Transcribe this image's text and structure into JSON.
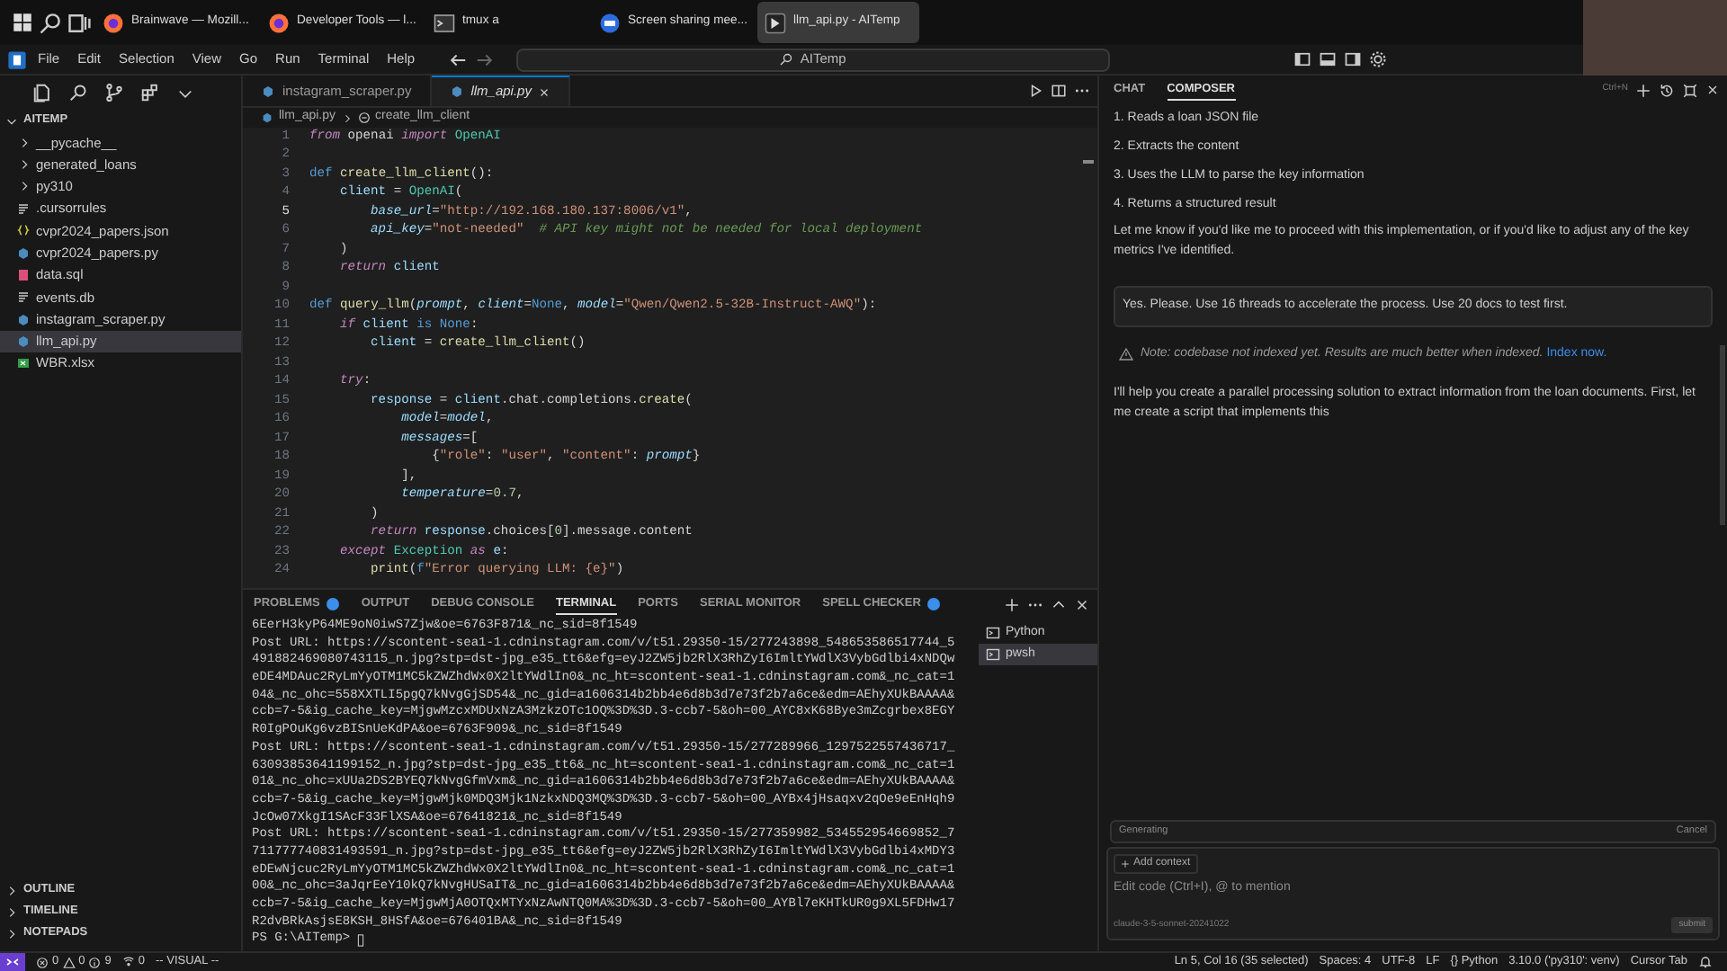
{
  "taskbar": {
    "apps": [
      {
        "label": "Brainwave — Mozill...",
        "kind": "browser",
        "selected": false
      },
      {
        "label": "Developer Tools — l...",
        "kind": "browser",
        "selected": false
      },
      {
        "label": "tmux a",
        "kind": "terminal",
        "selected": false
      },
      {
        "label": "Screen sharing mee...",
        "kind": "meeting",
        "selected": false
      },
      {
        "label": "llm_api.py - AITemp",
        "kind": "editor",
        "selected": true
      }
    ]
  },
  "menu_bar": {
    "items": [
      "File",
      "Edit",
      "Selection",
      "View",
      "Go",
      "Run",
      "Terminal",
      "Help"
    ],
    "command_center": "AITemp"
  },
  "sidebar": {
    "root": {
      "label": "AITEMP",
      "expanded": true
    },
    "items": [
      {
        "label": "__pycache__",
        "kind": "folder",
        "expanded": false,
        "selected": false
      },
      {
        "label": "generated_loans",
        "kind": "folder",
        "expanded": false,
        "selected": false
      },
      {
        "label": "py310",
        "kind": "folder",
        "expanded": false,
        "selected": false
      },
      {
        "label": ".cursorrules",
        "kind": "text",
        "selected": false
      },
      {
        "label": "cvpr2024_papers.json",
        "kind": "json",
        "selected": false
      },
      {
        "label": "cvpr2024_papers.py",
        "kind": "python",
        "selected": false
      },
      {
        "label": "data.sql",
        "kind": "sql",
        "selected": false
      },
      {
        "label": "events.db",
        "kind": "text",
        "selected": false
      },
      {
        "label": "instagram_scraper.py",
        "kind": "python",
        "selected": false
      },
      {
        "label": "llm_api.py",
        "kind": "python",
        "selected": true
      },
      {
        "label": "WBR.xlsx",
        "kind": "excel",
        "selected": false
      }
    ],
    "sections": [
      {
        "label": "OUTLINE",
        "expanded": false
      },
      {
        "label": "TIMELINE",
        "expanded": false
      },
      {
        "label": "NOTEPADS",
        "expanded": false
      }
    ]
  },
  "editor": {
    "tabs": [
      {
        "label": "instagram_scraper.py",
        "selected": false
      },
      {
        "label": "llm_api.py",
        "selected": true
      }
    ],
    "breadcrumb": [
      "llm_api.py",
      "create_llm_client"
    ],
    "lines": [
      {
        "number": "1",
        "current": false,
        "tokens": [
          {
            "kind": "kw",
            "text": "from"
          },
          {
            "kind": "plain",
            "text": " openai "
          },
          {
            "kind": "kw",
            "text": "import"
          },
          {
            "kind": "cls",
            "text": " OpenAI"
          }
        ]
      },
      {
        "number": "2",
        "current": false
      },
      {
        "number": "3",
        "current": false,
        "tokens": [
          {
            "kind": "def",
            "text": "def"
          },
          {
            "kind": "fn",
            "text": " create_llm_client"
          },
          {
            "kind": "plain",
            "text": "():"
          }
        ]
      },
      {
        "number": "4",
        "current": false,
        "tokens": [
          {
            "kind": "var",
            "text": "    client"
          },
          {
            "kind": "plain",
            "text": " = "
          },
          {
            "kind": "cls",
            "text": "OpenAI"
          },
          {
            "kind": "plain",
            "text": "("
          }
        ]
      },
      {
        "number": "5",
        "current": true,
        "tokens": [
          {
            "kind": "param",
            "text": "        base_url"
          },
          {
            "kind": "plain",
            "text": "="
          },
          {
            "kind": "str",
            "text": "\"http://192.168.180.137:8006/v1\""
          },
          {
            "kind": "plain",
            "text": ","
          }
        ]
      },
      {
        "number": "6",
        "current": false,
        "tokens": [
          {
            "kind": "param",
            "text": "        api_key"
          },
          {
            "kind": "plain",
            "text": "="
          },
          {
            "kind": "str",
            "text": "\"not-needed\""
          },
          {
            "kind": "comment",
            "text": "  # API key might not be needed for local deployment"
          }
        ]
      },
      {
        "number": "7",
        "current": false,
        "tokens": [
          {
            "kind": "plain",
            "text": "    )"
          }
        ]
      },
      {
        "number": "8",
        "current": false,
        "tokens": [
          {
            "kind": "kw",
            "text": "    return"
          },
          {
            "kind": "var",
            "text": " client"
          }
        ]
      },
      {
        "number": "9",
        "current": false
      },
      {
        "number": "10",
        "current": false,
        "tokens": [
          {
            "kind": "def",
            "text": "def"
          },
          {
            "kind": "fn",
            "text": " query_llm"
          },
          {
            "kind": "plain",
            "text": "("
          },
          {
            "kind": "param",
            "text": "prompt"
          },
          {
            "kind": "plain",
            "text": ", "
          },
          {
            "kind": "param",
            "text": "client"
          },
          {
            "kind": "plain",
            "text": "="
          },
          {
            "kind": "def",
            "text": "None"
          },
          {
            "kind": "plain",
            "text": ", "
          },
          {
            "kind": "param",
            "text": "model"
          },
          {
            "kind": "plain",
            "text": "="
          },
          {
            "kind": "str",
            "text": "\"Qwen/Qwen2.5-32B-Instruct-AWQ\""
          },
          {
            "kind": "plain",
            "text": "):"
          }
        ]
      },
      {
        "number": "11",
        "current": false,
        "tokens": [
          {
            "kind": "kw",
            "text": "    if"
          },
          {
            "kind": "var",
            "text": " client"
          },
          {
            "kind": "def",
            "text": " is"
          },
          {
            "kind": "def",
            "text": " None"
          },
          {
            "kind": "plain",
            "text": ":"
          }
        ]
      },
      {
        "number": "12",
        "current": false,
        "tokens": [
          {
            "kind": "var",
            "text": "        client"
          },
          {
            "kind": "plain",
            "text": " = "
          },
          {
            "kind": "fn",
            "text": "create_llm_client"
          },
          {
            "kind": "plain",
            "text": "()"
          }
        ]
      },
      {
        "number": "13",
        "current": false
      },
      {
        "number": "14",
        "current": false,
        "tokens": [
          {
            "kind": "kw",
            "text": "    try"
          },
          {
            "kind": "plain",
            "text": ":"
          }
        ]
      },
      {
        "number": "15",
        "current": false,
        "tokens": [
          {
            "kind": "var",
            "text": "        response"
          },
          {
            "kind": "plain",
            "text": " = "
          },
          {
            "kind": "var",
            "text": "client"
          },
          {
            "kind": "plain",
            "text": ".chat.completions."
          },
          {
            "kind": "fn",
            "text": "create"
          },
          {
            "kind": "plain",
            "text": "("
          }
        ]
      },
      {
        "number": "16",
        "current": false,
        "tokens": [
          {
            "kind": "param",
            "text": "            model"
          },
          {
            "kind": "plain",
            "text": "="
          },
          {
            "kind": "param",
            "text": "model"
          },
          {
            "kind": "plain",
            "text": ","
          }
        ]
      },
      {
        "number": "17",
        "current": false,
        "tokens": [
          {
            "kind": "param",
            "text": "            messages"
          },
          {
            "kind": "plain",
            "text": "=["
          }
        ]
      },
      {
        "number": "18",
        "current": false,
        "tokens": [
          {
            "kind": "plain",
            "text": "                {"
          },
          {
            "kind": "str",
            "text": "\"role\""
          },
          {
            "kind": "plain",
            "text": ": "
          },
          {
            "kind": "str",
            "text": "\"user\""
          },
          {
            "kind": "plain",
            "text": ", "
          },
          {
            "kind": "str",
            "text": "\"content\""
          },
          {
            "kind": "plain",
            "text": ": "
          },
          {
            "kind": "param",
            "text": "prompt"
          },
          {
            "kind": "plain",
            "text": "}"
          }
        ]
      },
      {
        "number": "19",
        "current": false,
        "tokens": [
          {
            "kind": "plain",
            "text": "            ],"
          }
        ]
      },
      {
        "number": "20",
        "current": false,
        "tokens": [
          {
            "kind": "param",
            "text": "            temperature"
          },
          {
            "kind": "plain",
            "text": "="
          },
          {
            "kind": "num",
            "text": "0.7"
          },
          {
            "kind": "plain",
            "text": ","
          }
        ]
      },
      {
        "number": "21",
        "current": false,
        "tokens": [
          {
            "kind": "plain",
            "text": "        )"
          }
        ]
      },
      {
        "number": "22",
        "current": false,
        "tokens": [
          {
            "kind": "kw",
            "text": "        return"
          },
          {
            "kind": "var",
            "text": " response"
          },
          {
            "kind": "plain",
            "text": ".choices["
          },
          {
            "kind": "num",
            "text": "0"
          },
          {
            "kind": "plain",
            "text": "].message.content"
          }
        ]
      },
      {
        "number": "23",
        "current": false,
        "tokens": [
          {
            "kind": "kw",
            "text": "    except"
          },
          {
            "kind": "cls",
            "text": " Exception"
          },
          {
            "kind": "kw",
            "text": " as"
          },
          {
            "kind": "var",
            "text": " e"
          },
          {
            "kind": "plain",
            "text": ":"
          }
        ]
      },
      {
        "number": "24",
        "current": false,
        "tokens": [
          {
            "kind": "fn",
            "text": "        print"
          },
          {
            "kind": "plain",
            "text": "("
          },
          {
            "kind": "def",
            "text": "f"
          },
          {
            "kind": "str",
            "text": "\"Error querying LLM: {e}\""
          },
          {
            "kind": "plain",
            "text": ")"
          }
        ]
      }
    ]
  },
  "panel": {
    "tabs": [
      {
        "label": "PROBLEMS",
        "badge": true,
        "selected": false
      },
      {
        "label": "OUTPUT",
        "badge": false,
        "selected": false
      },
      {
        "label": "DEBUG CONSOLE",
        "badge": false,
        "selected": false
      },
      {
        "label": "TERMINAL",
        "badge": false,
        "selected": true
      },
      {
        "label": "PORTS",
        "badge": false,
        "selected": false
      },
      {
        "label": "SERIAL MONITOR",
        "badge": false,
        "selected": false
      },
      {
        "label": "SPELL CHECKER",
        "badge": true,
        "selected": false
      }
    ],
    "terminal_lines": [
      "6EerH3kyP64ME9oN0iwS7Zjw&oe=6763F871&_nc_sid=8f1549",
      "Post URL: https://scontent-sea1-1.cdninstagram.com/v/t51.29350-15/277243898_548653586517744_5",
      "491882469080743115_n.jpg?stp=dst-jpg_e35_tt6&efg=eyJ2ZW5jb2RlX3RhZyI6ImltYWdlX3VybGdlbi4xNDQw",
      "eDE4MDAuc2RyLmYyOTM1MC5kZWZhdWx0X2ltYWdlIn0&_nc_ht=scontent-sea1-1.cdninstagram.com&_nc_cat=1",
      "04&_nc_ohc=558XXTLI5pgQ7kNvgGjSD54&_nc_gid=a1606314b2bb4e6d8b3d7e73f2b7a6ce&edm=AEhyXUkBAAAA&",
      "ccb=7-5&ig_cache_key=MjgwMzcxMDUxNzA3MzkzOTc1OQ%3D%3D.3-ccb7-5&oh=00_AYC8xK68Bye3mZcgrbex8EGY",
      "R0IgPOuKg6vzBISnUeKdPA&oe=6763F909&_nc_sid=8f1549",
      "Post URL: https://scontent-sea1-1.cdninstagram.com/v/t51.29350-15/277289966_1297522557436717_",
      "63093853641199152_n.jpg?stp=dst-jpg_e35_tt6&_nc_ht=scontent-sea1-1.cdninstagram.com&_nc_cat=1",
      "01&_nc_ohc=xUUa2DS2BYEQ7kNvgGfmVxm&_nc_gid=a1606314b2bb4e6d8b3d7e73f2b7a6ce&edm=AEhyXUkBAAAA&",
      "ccb=7-5&ig_cache_key=MjgwMjk0MDQ3Mjk1NzkxNDQ3MQ%3D%3D.3-ccb7-5&oh=00_AYBx4jHsaqxv2qOe9eEnHqh9",
      "JcOw07XkgI1SAcF33FlXSA&oe=67641821&_nc_sid=8f1549",
      "Post URL: https://scontent-sea1-1.cdninstagram.com/v/t51.29350-15/277359982_534552954669852_7",
      "711777740831493591_n.jpg?stp=dst-jpg_e35_tt6&efg=eyJ2ZW5jb2RlX3RhZyI6ImltYWdlX3VybGdlbi4xMDY3",
      "eDEwNjcuc2RyLmYyOTM1MC5kZWZhdWx0X2ltYWdlIn0&_nc_ht=scontent-sea1-1.cdninstagram.com&_nc_cat=1",
      "00&_nc_ohc=3aJqrEeY10kQ7kNvgHUSaIT&_nc_gid=a1606314b2bb4e6d8b3d7e73f2b7a6ce&edm=AEhyXUkBAAAA&",
      "ccb=7-5&ig_cache_key=MjgwMjA0OTQxMTYxNzAwNTQ0MA%3D%3D.3-ccb7-5&oh=00_AYBl7eKHTkUR0g9XL5FDHw17",
      "R2dvBRkAsjsE8KSH_8HSfA&oe=676401BA&_nc_sid=8f1549"
    ],
    "prompt": "PS G:\\AITemp>",
    "terminals": [
      {
        "label": "Python",
        "selected": false
      },
      {
        "label": "pwsh",
        "selected": true
      }
    ]
  },
  "composer": {
    "tabs": [
      {
        "label": "CHAT",
        "selected": false
      },
      {
        "label": "COMPOSER",
        "selected": true
      }
    ],
    "shortcut": "Ctrl+N",
    "messages": [
      {
        "kind": "list",
        "items": [
          "1. Reads a loan JSON file",
          "2. Extracts the content",
          "3. Uses the LLM to parse the key information",
          "4. Returns a structured result"
        ]
      },
      {
        "kind": "assistant",
        "text": "Let me know if you'd like me to proceed with this implementation, or if you'd like to adjust any of the key metrics I've identified."
      },
      {
        "kind": "user",
        "text": "Yes. Please. Use 16 threads to accelerate the process. Use 20 docs to test first."
      },
      {
        "kind": "note",
        "text": "Note: codebase not indexed yet. Results are much better when indexed.",
        "link": "Index now."
      },
      {
        "kind": "assistant",
        "text": "I'll help you create a parallel processing solution to extract information from the loan documents. First, let me create a script that implements this"
      }
    ],
    "status": "Generating",
    "cancel": "Cancel",
    "add_context": "Add context",
    "placeholder": "Edit code (Ctrl+I), @ to mention",
    "model": "claude-3-5-sonnet-20241022",
    "submit": "submit"
  },
  "status_bar": {
    "errors": "0",
    "warnings": "0",
    "infos": "9",
    "ports": "0",
    "mode": "-- VISUAL --",
    "right": [
      "Ln 5, Col 16 (35 selected)",
      "Spaces: 4",
      "UTF-8",
      "LF",
      "{} Python",
      "3.10.0 ('py310': venv)",
      "Cursor Tab"
    ]
  }
}
